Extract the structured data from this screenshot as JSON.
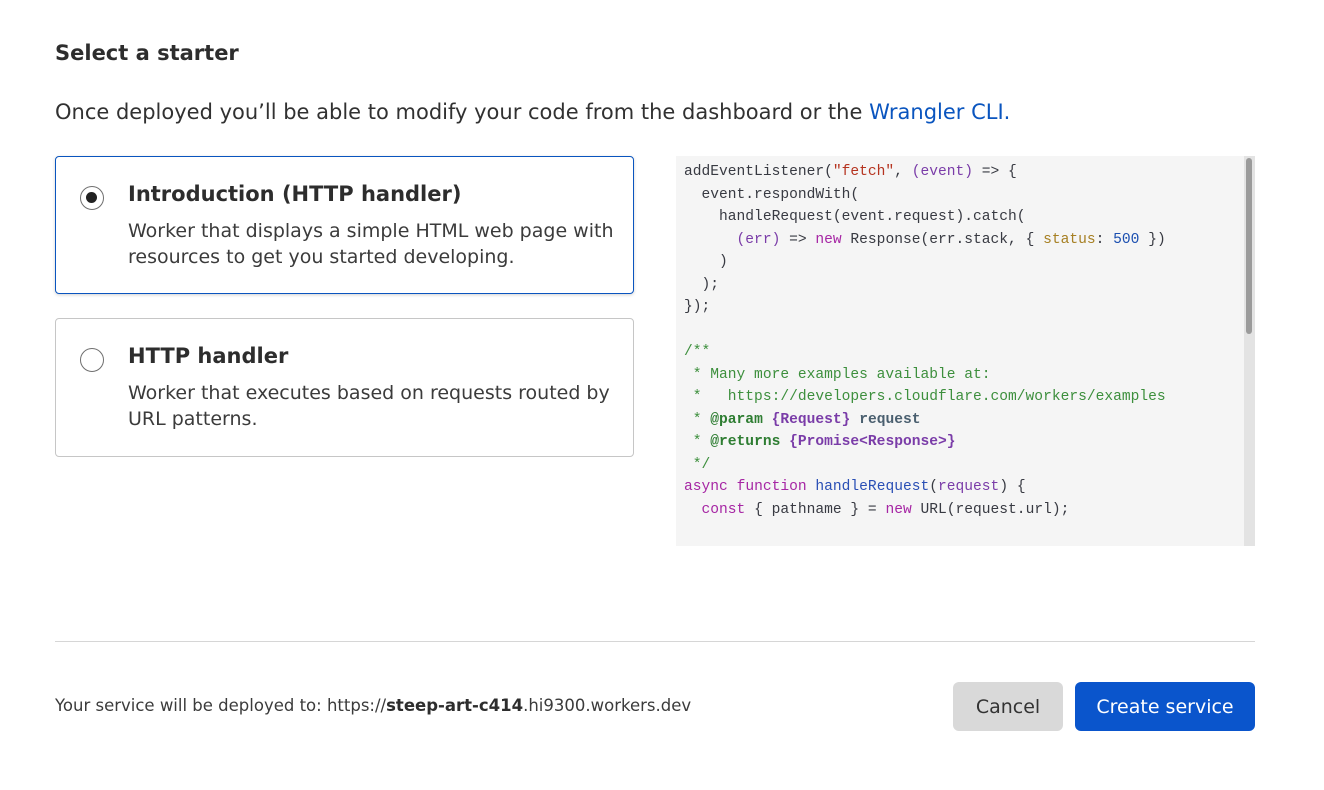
{
  "heading": "Select a starter",
  "intro": {
    "text": "Once deployed you’ll be able to modify your code from the dashboard or the ",
    "link": "Wrangler CLI."
  },
  "starters": [
    {
      "title": "Introduction (HTTP handler)",
      "description": "Worker that displays a simple HTML web page with resources to get you started developing.",
      "selected": true
    },
    {
      "title": "HTTP handler",
      "description": "Worker that executes based on requests routed by URL patterns.",
      "selected": false
    }
  ],
  "code": {
    "lines": [
      [
        [
          "addEventListener(",
          "plain"
        ],
        [
          "\"fetch\"",
          "str"
        ],
        [
          ", ",
          "plain"
        ],
        [
          "(event)",
          "param"
        ],
        [
          " => {",
          "plain"
        ]
      ],
      [
        [
          "  event.respondWith(",
          "plain"
        ]
      ],
      [
        [
          "    handleRequest(event.request).catch(",
          "plain"
        ]
      ],
      [
        [
          "      ",
          "plain"
        ],
        [
          "(err)",
          "param"
        ],
        [
          " => ",
          "plain"
        ],
        [
          "new",
          "kw"
        ],
        [
          " Response(err.stack, { ",
          "plain"
        ],
        [
          "status",
          "prop"
        ],
        [
          ": ",
          "plain"
        ],
        [
          "500",
          "num"
        ],
        [
          " })",
          "plain"
        ]
      ],
      [
        [
          "    )",
          "plain"
        ]
      ],
      [
        [
          "  );",
          "plain"
        ]
      ],
      [
        [
          "});",
          "plain"
        ]
      ],
      [
        [
          "",
          "plain"
        ]
      ],
      [
        [
          "/**",
          "comment"
        ]
      ],
      [
        [
          " * Many more examples available at:",
          "comment"
        ]
      ],
      [
        [
          " *   https://developers.cloudflare.com/workers/examples",
          "comment"
        ]
      ],
      [
        [
          " * ",
          "comment"
        ],
        [
          "@param",
          "doctag"
        ],
        [
          " ",
          "comment"
        ],
        [
          "{Request}",
          "doctype"
        ],
        [
          " ",
          "comment"
        ],
        [
          "request",
          "docname"
        ]
      ],
      [
        [
          " * ",
          "comment"
        ],
        [
          "@returns",
          "doctag"
        ],
        [
          " ",
          "comment"
        ],
        [
          "{Promise<Response>}",
          "doctype"
        ]
      ],
      [
        [
          " */",
          "comment"
        ]
      ],
      [
        [
          "async",
          "kw"
        ],
        [
          " ",
          "plain"
        ],
        [
          "function",
          "kw"
        ],
        [
          " ",
          "plain"
        ],
        [
          "handleRequest",
          "fn"
        ],
        [
          "(",
          "plain"
        ],
        [
          "request",
          "param"
        ],
        [
          ") {",
          "plain"
        ]
      ],
      [
        [
          "  ",
          "plain"
        ],
        [
          "const",
          "kw"
        ],
        [
          " { pathname } = ",
          "plain"
        ],
        [
          "new",
          "kw"
        ],
        [
          " URL(request.url);",
          "plain"
        ]
      ]
    ]
  },
  "deploy": {
    "prefix": "Your service will be deployed to: https://",
    "subdomain": "steep-art-c414",
    "suffix": ".hi9300.workers.dev"
  },
  "actions": {
    "cancel_label": "Cancel",
    "create_label": "Create service"
  },
  "colors": {
    "accent": "#0a55cc",
    "link": "#0a55bf"
  }
}
